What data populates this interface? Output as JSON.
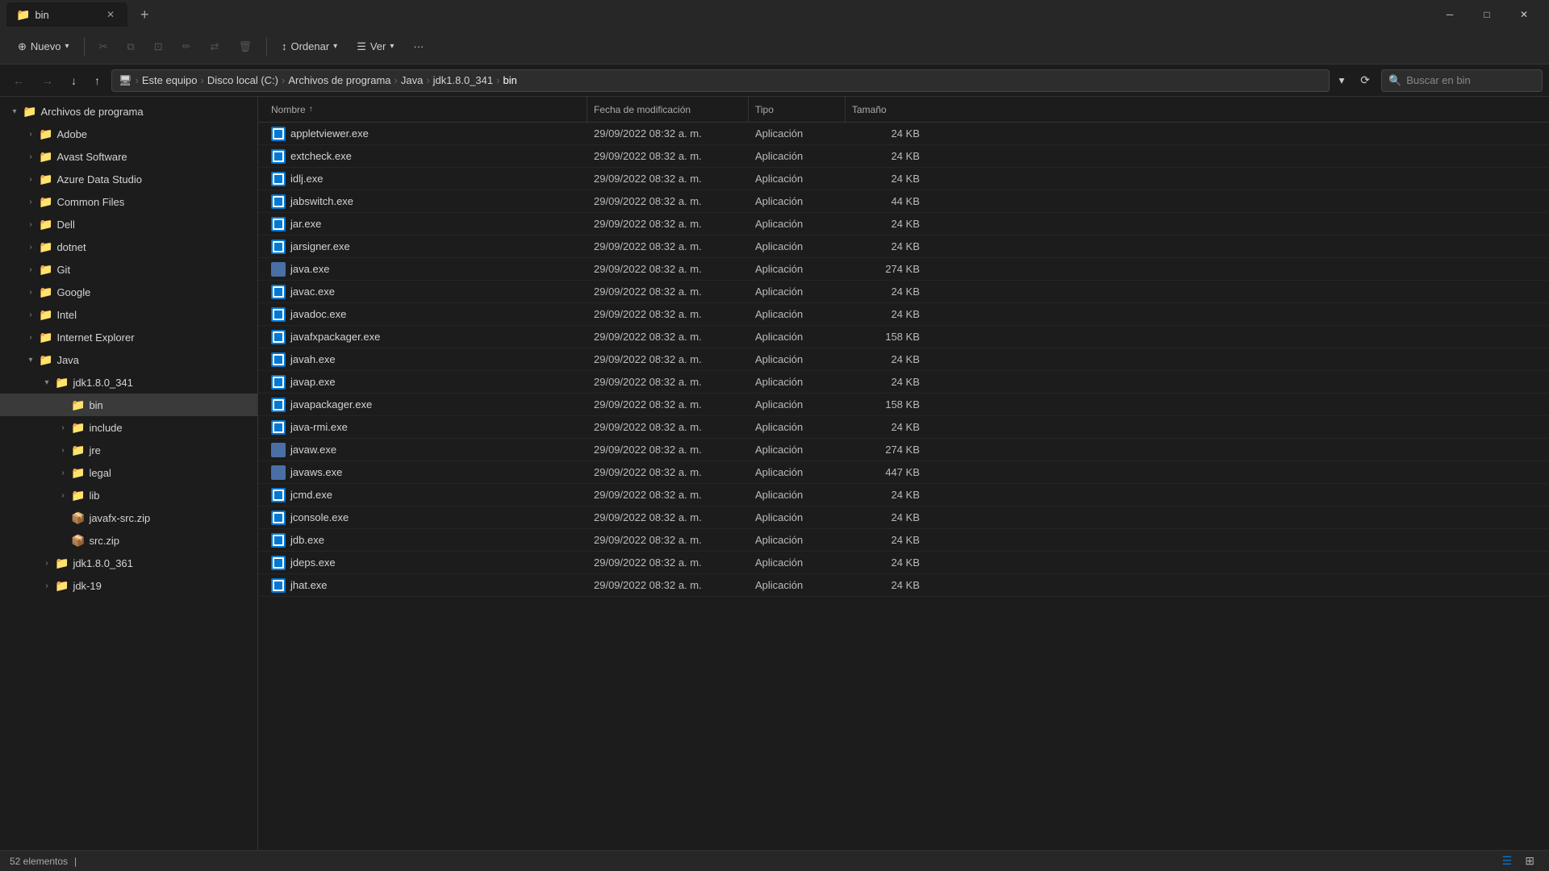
{
  "titlebar": {
    "tab_label": "bin",
    "tab_icon": "📁",
    "new_tab_label": "+",
    "minimize_label": "─",
    "maximize_label": "□",
    "close_label": "✕"
  },
  "toolbar": {
    "nuevo_label": "Nuevo",
    "cut_icon": "✂",
    "copy_icon": "⧉",
    "paste_icon": "⊡",
    "rename_icon": "✏",
    "move_icon": "⇄",
    "delete_icon": "🗑",
    "ordenar_label": "Ordenar",
    "ver_label": "Ver",
    "more_icon": "···"
  },
  "addressbar": {
    "back_icon": "←",
    "forward_icon": "→",
    "down_icon": "↓",
    "up_icon": "↑",
    "breadcrumb": [
      {
        "label": "Este equipo"
      },
      {
        "label": "Disco local (C:)"
      },
      {
        "label": "Archivos de programa"
      },
      {
        "label": "Java"
      },
      {
        "label": "jdk1.8.0_341"
      },
      {
        "label": "bin",
        "active": true
      }
    ],
    "search_placeholder": "Buscar en bin",
    "refresh_icon": "⟳"
  },
  "sidebar": {
    "items": [
      {
        "label": "Archivos de programa",
        "level": 1,
        "expanded": true,
        "arrow": "▾",
        "icon": "📁"
      },
      {
        "label": "Adobe",
        "level": 2,
        "expanded": false,
        "arrow": "›",
        "icon": "📁"
      },
      {
        "label": "Avast Software",
        "level": 2,
        "expanded": false,
        "arrow": "›",
        "icon": "📁"
      },
      {
        "label": "Azure Data Studio",
        "level": 2,
        "expanded": false,
        "arrow": "›",
        "icon": "📁"
      },
      {
        "label": "Common Files",
        "level": 2,
        "expanded": false,
        "arrow": "›",
        "icon": "📁"
      },
      {
        "label": "Dell",
        "level": 2,
        "expanded": false,
        "arrow": "›",
        "icon": "📁"
      },
      {
        "label": "dotnet",
        "level": 2,
        "expanded": false,
        "arrow": "›",
        "icon": "📁"
      },
      {
        "label": "Git",
        "level": 2,
        "expanded": false,
        "arrow": "›",
        "icon": "📁"
      },
      {
        "label": "Google",
        "level": 2,
        "expanded": false,
        "arrow": "›",
        "icon": "📁"
      },
      {
        "label": "Intel",
        "level": 2,
        "expanded": false,
        "arrow": "›",
        "icon": "📁"
      },
      {
        "label": "Internet Explorer",
        "level": 2,
        "expanded": false,
        "arrow": "›",
        "icon": "📁"
      },
      {
        "label": "Java",
        "level": 2,
        "expanded": true,
        "arrow": "▾",
        "icon": "📁"
      },
      {
        "label": "jdk1.8.0_341",
        "level": 3,
        "expanded": true,
        "arrow": "▾",
        "icon": "📁"
      },
      {
        "label": "bin",
        "level": 4,
        "expanded": false,
        "arrow": "",
        "icon": "📁",
        "selected": true
      },
      {
        "label": "include",
        "level": 4,
        "expanded": false,
        "arrow": "›",
        "icon": "📁"
      },
      {
        "label": "jre",
        "level": 4,
        "expanded": false,
        "arrow": "›",
        "icon": "📁"
      },
      {
        "label": "legal",
        "level": 4,
        "expanded": false,
        "arrow": "›",
        "icon": "📁"
      },
      {
        "label": "lib",
        "level": 4,
        "expanded": false,
        "arrow": "›",
        "icon": "📁"
      },
      {
        "label": "javafx-src.zip",
        "level": 4,
        "expanded": false,
        "arrow": "",
        "icon": "📦"
      },
      {
        "label": "src.zip",
        "level": 4,
        "expanded": false,
        "arrow": "",
        "icon": "📦"
      },
      {
        "label": "jdk1.8.0_361",
        "level": 3,
        "expanded": false,
        "arrow": "›",
        "icon": "📁"
      },
      {
        "label": "jdk-19",
        "level": 3,
        "expanded": false,
        "arrow": "›",
        "icon": "📁"
      }
    ]
  },
  "file_list": {
    "headers": [
      {
        "label": "Nombre",
        "sort_icon": "↑"
      },
      {
        "label": "Fecha de modificación"
      },
      {
        "label": "Tipo"
      },
      {
        "label": "Tamaño"
      }
    ],
    "files": [
      {
        "name": "appletviewer.exe",
        "date": "29/09/2022 08:32 a. m.",
        "type": "Aplicación",
        "size": "24 KB",
        "icon": "blue"
      },
      {
        "name": "extcheck.exe",
        "date": "29/09/2022 08:32 a. m.",
        "type": "Aplicación",
        "size": "24 KB",
        "icon": "blue"
      },
      {
        "name": "idlj.exe",
        "date": "29/09/2022 08:32 a. m.",
        "type": "Aplicación",
        "size": "24 KB",
        "icon": "blue"
      },
      {
        "name": "jabswitch.exe",
        "date": "29/09/2022 08:32 a. m.",
        "type": "Aplicación",
        "size": "44 KB",
        "icon": "blue"
      },
      {
        "name": "jar.exe",
        "date": "29/09/2022 08:32 a. m.",
        "type": "Aplicación",
        "size": "24 KB",
        "icon": "blue"
      },
      {
        "name": "jarsigner.exe",
        "date": "29/09/2022 08:32 a. m.",
        "type": "Aplicación",
        "size": "24 KB",
        "icon": "blue"
      },
      {
        "name": "java.exe",
        "date": "29/09/2022 08:32 a. m.",
        "type": "Aplicación",
        "size": "274 KB",
        "icon": "special"
      },
      {
        "name": "javac.exe",
        "date": "29/09/2022 08:32 a. m.",
        "type": "Aplicación",
        "size": "24 KB",
        "icon": "blue"
      },
      {
        "name": "javadoc.exe",
        "date": "29/09/2022 08:32 a. m.",
        "type": "Aplicación",
        "size": "24 KB",
        "icon": "blue"
      },
      {
        "name": "javafxpackager.exe",
        "date": "29/09/2022 08:32 a. m.",
        "type": "Aplicación",
        "size": "158 KB",
        "icon": "blue"
      },
      {
        "name": "javah.exe",
        "date": "29/09/2022 08:32 a. m.",
        "type": "Aplicación",
        "size": "24 KB",
        "icon": "blue"
      },
      {
        "name": "javap.exe",
        "date": "29/09/2022 08:32 a. m.",
        "type": "Aplicación",
        "size": "24 KB",
        "icon": "blue"
      },
      {
        "name": "javapackager.exe",
        "date": "29/09/2022 08:32 a. m.",
        "type": "Aplicación",
        "size": "158 KB",
        "icon": "blue"
      },
      {
        "name": "java-rmi.exe",
        "date": "29/09/2022 08:32 a. m.",
        "type": "Aplicación",
        "size": "24 KB",
        "icon": "blue"
      },
      {
        "name": "javaw.exe",
        "date": "29/09/2022 08:32 a. m.",
        "type": "Aplicación",
        "size": "274 KB",
        "icon": "special"
      },
      {
        "name": "javaws.exe",
        "date": "29/09/2022 08:32 a. m.",
        "type": "Aplicación",
        "size": "447 KB",
        "icon": "special"
      },
      {
        "name": "jcmd.exe",
        "date": "29/09/2022 08:32 a. m.",
        "type": "Aplicación",
        "size": "24 KB",
        "icon": "blue"
      },
      {
        "name": "jconsole.exe",
        "date": "29/09/2022 08:32 a. m.",
        "type": "Aplicación",
        "size": "24 KB",
        "icon": "blue"
      },
      {
        "name": "jdb.exe",
        "date": "29/09/2022 08:32 a. m.",
        "type": "Aplicación",
        "size": "24 KB",
        "icon": "blue"
      },
      {
        "name": "jdeps.exe",
        "date": "29/09/2022 08:32 a. m.",
        "type": "Aplicación",
        "size": "24 KB",
        "icon": "blue"
      },
      {
        "name": "jhat.exe",
        "date": "29/09/2022 08:32 a. m.",
        "type": "Aplicación",
        "size": "24 KB",
        "icon": "blue"
      }
    ]
  },
  "statusbar": {
    "count_text": "52 elementos",
    "separator": "|",
    "view_details_icon": "☰",
    "view_grid_icon": "⊞"
  }
}
